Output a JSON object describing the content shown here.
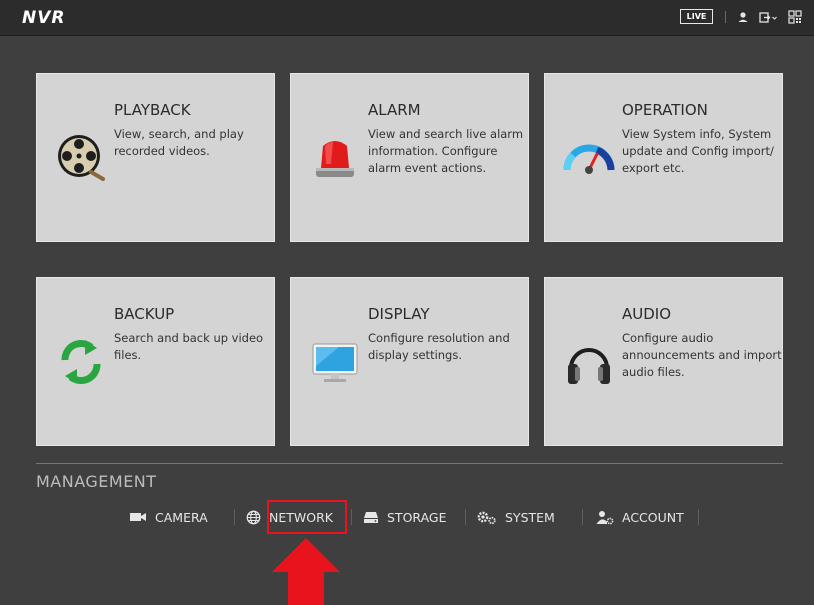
{
  "topbar": {
    "logo": "NVR",
    "live_label": "LIVE",
    "icons": [
      "user-icon",
      "logout-icon",
      "qr-code-icon"
    ]
  },
  "cards": [
    {
      "title": "PLAYBACK",
      "desc": "View, search, and play\nrecorded videos.",
      "icon": "film-reel-icon"
    },
    {
      "title": "ALARM",
      "desc": "View and search live alarm\ninformation. Configure\nalarm event actions.",
      "icon": "alarm-siren-icon"
    },
    {
      "title": "OPERATION",
      "desc": "View System info, System\nupdate and Config import/\nexport etc.",
      "icon": "gauge-icon"
    },
    {
      "title": "BACKUP",
      "desc": "Search and back up video\nfiles.",
      "icon": "refresh-icon"
    },
    {
      "title": "DISPLAY",
      "desc": "Configure resolution and\ndisplay settings.",
      "icon": "monitor-icon"
    },
    {
      "title": "AUDIO",
      "desc": "Configure audio\nannouncements and import\n audio files.",
      "icon": "headphones-icon"
    }
  ],
  "management": {
    "title": "MANAGEMENT",
    "items": [
      {
        "label": "CAMERA",
        "icon": "camera-icon"
      },
      {
        "label": "NETWORK",
        "icon": "globe-icon",
        "highlighted": true
      },
      {
        "label": "STORAGE",
        "icon": "hard-drive-icon"
      },
      {
        "label": "SYSTEM",
        "icon": "gears-icon"
      },
      {
        "label": "ACCOUNT",
        "icon": "account-gear-icon"
      }
    ]
  },
  "colors": {
    "background": "#3f3f3f",
    "topbar": "#2c2c2c",
    "card": "#d4d4d4",
    "highlight": "#e8131c"
  }
}
